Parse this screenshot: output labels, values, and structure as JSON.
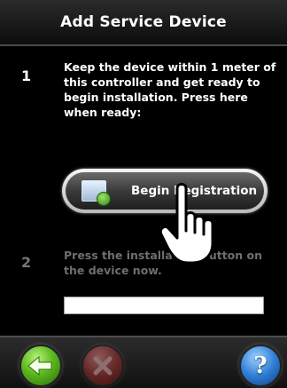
{
  "header": {
    "title": "Add Service Device"
  },
  "steps": [
    {
      "number": "1",
      "text": "Keep the device within 1 meter of this controller and get ready to begin installation. Press here when ready:"
    },
    {
      "number": "2",
      "text": "Press the installation button on the device now."
    }
  ],
  "begin_button": {
    "label": "Begin Registration",
    "icon": "device-add-icon"
  },
  "registration_field": {
    "value": ""
  },
  "footer": {
    "back": {
      "icon": "back-arrow-icon",
      "color": "#5cb81e"
    },
    "cancel": {
      "icon": "close-icon",
      "color": "#a33131",
      "enabled": false
    },
    "help": {
      "icon": "question-mark-icon",
      "label": "?",
      "color": "#2f7fd6"
    }
  },
  "cursor": {
    "icon": "hand-pointer-icon"
  }
}
